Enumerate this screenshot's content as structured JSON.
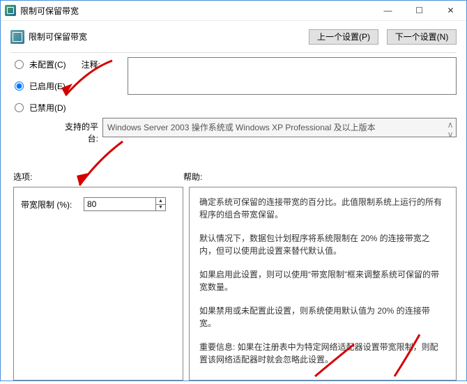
{
  "window": {
    "title": "限制可保留带宽"
  },
  "header": {
    "title": "限制可保留带宽",
    "prev_label": "上一个设置(P)",
    "next_label": "下一个设置(N)"
  },
  "config_state": {
    "not_configured": "未配置(C)",
    "enabled": "已启用(E)",
    "disabled": "已禁用(D)",
    "selected": "enabled"
  },
  "comment": {
    "label": "注释:",
    "value": ""
  },
  "platform": {
    "label": "支持的平台:",
    "value": "Windows Server 2003 操作系统或 Windows XP Professional 及以上版本"
  },
  "sections": {
    "options_label": "选项:",
    "help_label": "帮助:"
  },
  "options": {
    "limit_label": "带宽限制 (%):",
    "limit_value": "80"
  },
  "help": {
    "p1": "确定系统可保留的连接带宽的百分比。此值限制系统上运行的所有程序的组合带宽保留。",
    "p2": "默认情况下，数据包计划程序将系统限制在 20% 的连接带宽之内，但可以使用此设置来替代默认值。",
    "p3": "如果启用此设置，则可以使用“带宽限制”框来调整系统可保留的带宽数量。",
    "p4": "如果禁用或未配置此设置，则系统使用默认值为 20% 的连接带宽。",
    "p5": "重要信息: 如果在注册表中为特定网络适配器设置带宽限制，则配置该网络适配器时就会忽略此设置。"
  }
}
